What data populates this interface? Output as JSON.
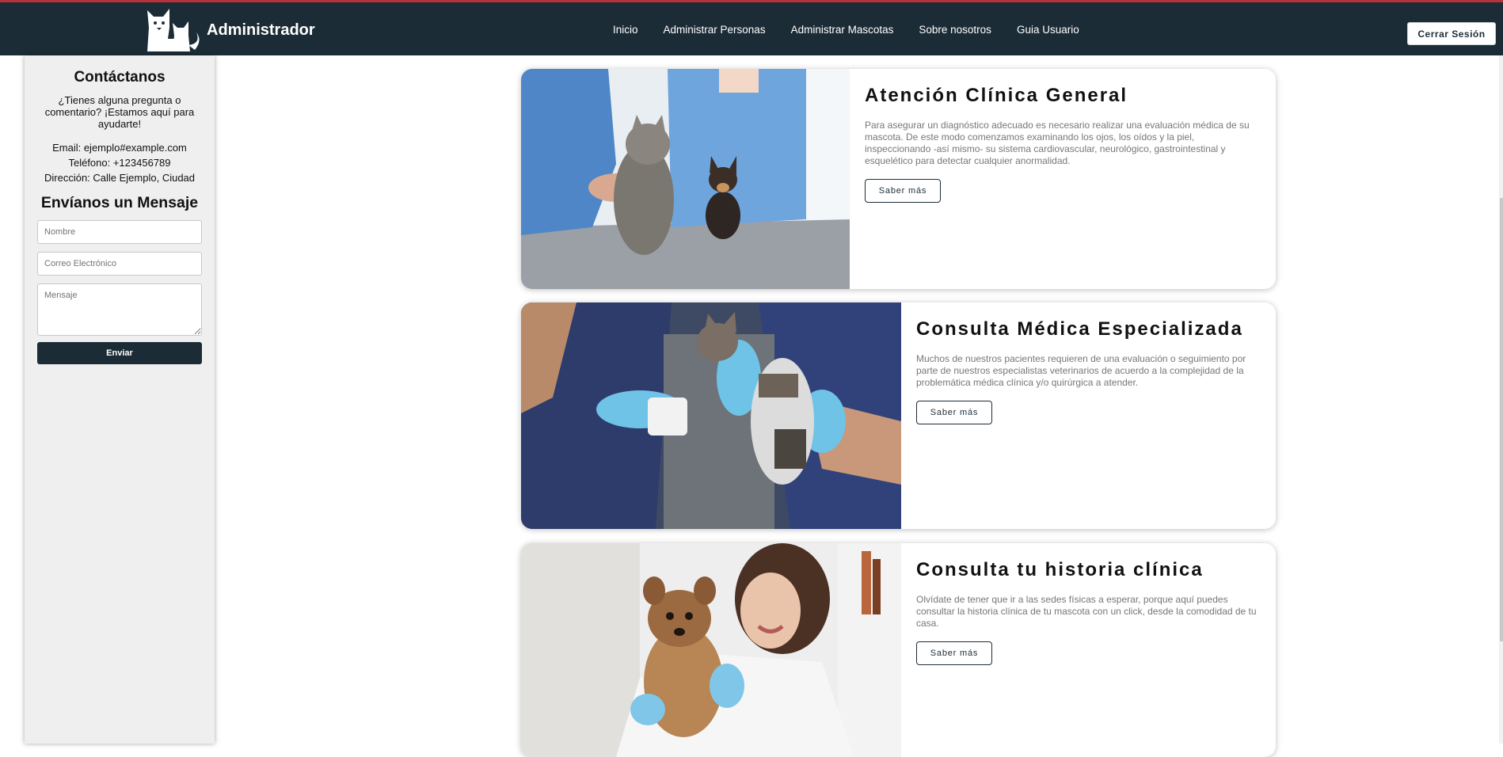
{
  "header": {
    "brand_title": "Administrador",
    "nav": [
      "Inicio",
      "Administrar Personas",
      "Administrar Mascotas",
      "Sobre nosotros",
      "Guia Usuario"
    ],
    "logout_label": "Cerrar Sesión",
    "logo_icon": "cat-dog-logo-icon"
  },
  "sidebar": {
    "title": "Contáctanos",
    "intro": "¿Tienes alguna pregunta o comentario? ¡Estamos aquí para ayudarte!",
    "email": "Email: ejemplo#example.com",
    "phone": "Teléfono: +123456789",
    "address": "Dirección: Calle Ejemplo, Ciudad",
    "form_title": "Envíanos un Mensaje",
    "name_placeholder": "Nombre",
    "email_placeholder": "Correo Electrónico",
    "message_placeholder": "Mensaje",
    "send_label": "Enviar"
  },
  "services": [
    {
      "title": "Atención Clínica General",
      "text": "Para asegurar un diagnóstico adecuado es necesario realizar una evaluación médica de su mascota. De este modo comenzamos examinando los ojos, los oídos y la piel, inspeccionando -así mismo- su sistema cardiovascular, neurológico, gastrointestinal y esquelético para detectar cualquier anormalidad.",
      "button": "Saber más"
    },
    {
      "title": "Consulta Médica Especializada",
      "text": "Muchos de nuestros pacientes requieren de una evaluación o seguimiento por parte de nuestros especialistas veterinarios de acuerdo a la complejidad de la problemática médica clínica y/o quirúrgica a atender.",
      "button": "Saber más"
    },
    {
      "title": "Consulta tu historia clínica",
      "text": "Olvídate de tener que ir a las sedes físicas a esperar, porque aquí puedes consultar la historia clínica de tu mascota con un click, desde la comodidad de tu casa.",
      "button": "Saber más"
    }
  ],
  "colors": {
    "navbar": "#1c2c36",
    "accent_line": "#b8323a",
    "sidebar_bg": "#efefef"
  }
}
